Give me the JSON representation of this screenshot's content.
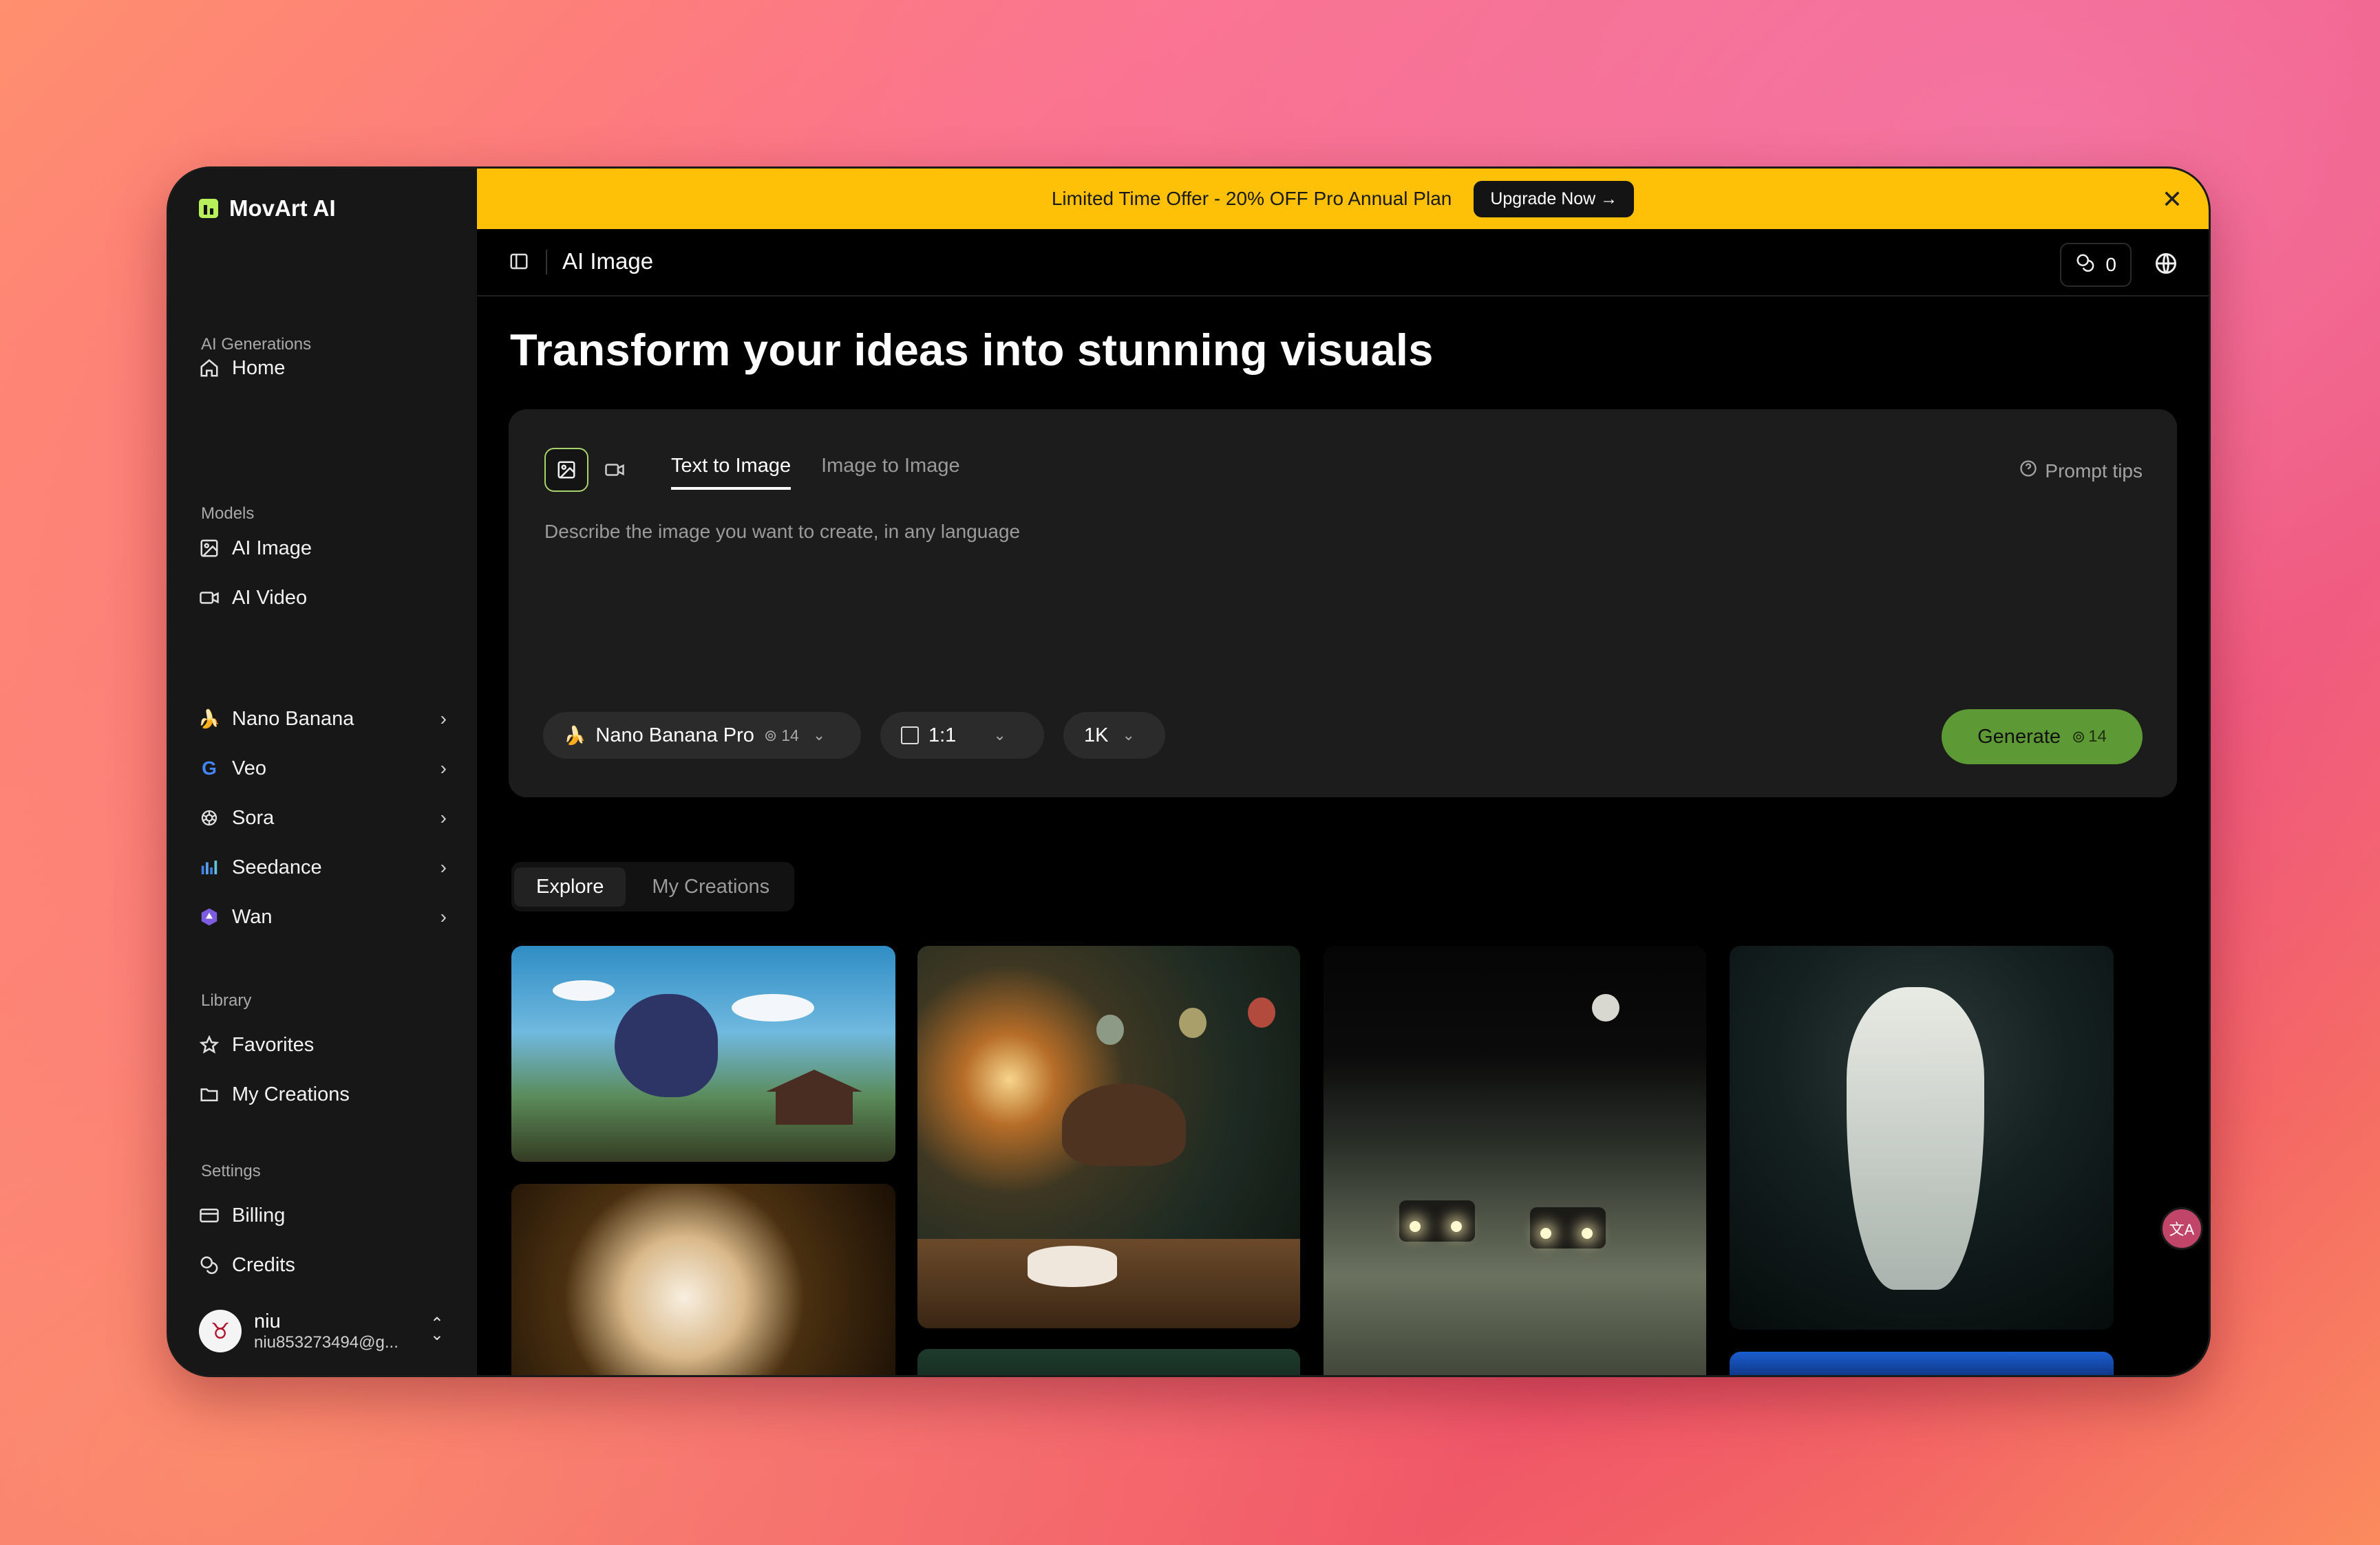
{
  "app": {
    "name": "MovArt AI"
  },
  "sidebar": {
    "home": "Home",
    "sections": {
      "ai_generations": "AI Generations",
      "models": "Models",
      "library": "Library",
      "settings": "Settings"
    },
    "ai_generations": [
      {
        "label": "AI Image",
        "icon": "image-icon"
      },
      {
        "label": "AI Video",
        "icon": "video-icon"
      }
    ],
    "models": [
      {
        "label": "Nano Banana",
        "icon": "banana-icon"
      },
      {
        "label": "Veo",
        "icon": "google-icon"
      },
      {
        "label": "Sora",
        "icon": "openai-icon"
      },
      {
        "label": "Seedance",
        "icon": "seedance-icon"
      },
      {
        "label": "Wan",
        "icon": "wan-icon"
      }
    ],
    "library": [
      {
        "label": "Favorites",
        "icon": "star-icon"
      },
      {
        "label": "My Creations",
        "icon": "folder-icon"
      }
    ],
    "settings": [
      {
        "label": "Billing",
        "icon": "card-icon"
      },
      {
        "label": "Credits",
        "icon": "coins-icon"
      }
    ],
    "user": {
      "name": "niu",
      "email": "niu853273494@g..."
    }
  },
  "banner": {
    "text": "Limited Time Offer - 20% OFF Pro Annual Plan",
    "button": "Upgrade Now →",
    "close": "✕"
  },
  "topbar": {
    "title": "AI Image",
    "credits": "0"
  },
  "headline": "Transform your ideas into stunning visuals",
  "composer": {
    "tabs": [
      "Text to Image",
      "Image to Image"
    ],
    "active_tab": "Text to Image",
    "prompt_tips": "Prompt tips",
    "placeholder": "Describe the image you want to create, in any language",
    "prompt_value": "",
    "model": {
      "label": "Nano Banana Pro",
      "cost": "14"
    },
    "aspect": "1:1",
    "resolution": "1K",
    "generate": {
      "label": "Generate",
      "cost": "14"
    }
  },
  "gallery": {
    "tabs": [
      "Explore",
      "My Creations"
    ],
    "active_tab": "Explore"
  },
  "colors": {
    "banner": "#ffc107",
    "accent_green": "#5d9a35",
    "sidebar_bg": "#171717",
    "composer_bg": "#1c1c1c"
  }
}
